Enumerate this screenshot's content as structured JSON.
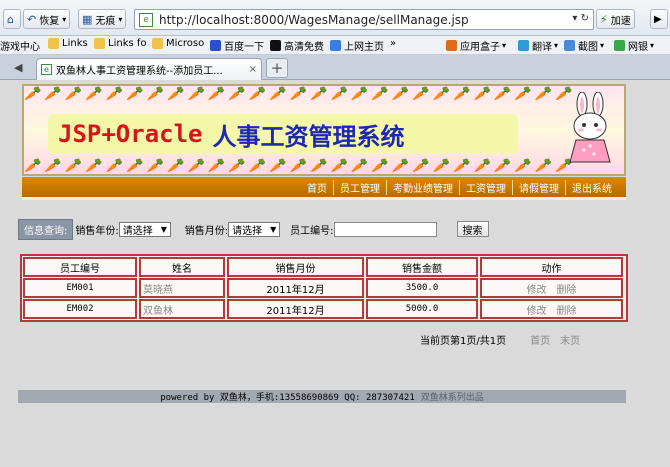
{
  "browser": {
    "back_label": "",
    "restore_label": "恢复",
    "no_trace_label": "无痕",
    "url": "http://localhost:8000/WagesManage/sellManage.jsp",
    "speedup_label": "加速",
    "bookmarks": [
      "游戏中心",
      "Links",
      "Links fo",
      "Microso",
      "百度一下",
      "高清免费",
      "上网主页",
      "»",
      "应用盒子",
      "翻译",
      "截图",
      "网银"
    ],
    "tab_title": "双鱼林人事工资管理系统--添加员工..."
  },
  "banner": {
    "title_en": "JSP+Oracle",
    "title_cn": "人事工资管理系统"
  },
  "nav": [
    "首页",
    "员工管理",
    "考勤业绩管理",
    "工资管理",
    "请假管理",
    "退出系统"
  ],
  "query": {
    "label": "信息查询:",
    "year_label": "销售年份:",
    "year_value": "请选择",
    "month_label": "销售月份:",
    "month_value": "请选择",
    "emp_label": "员工编号:",
    "emp_value": "",
    "search_label": "搜索"
  },
  "table": {
    "headers": [
      "员工编号",
      "姓名",
      "销售月份",
      "销售金额",
      "动作"
    ],
    "rows": [
      {
        "emp_no": "EM001",
        "name": "莫晓燕",
        "month": "2011年12月",
        "amount": "3500.0",
        "edit": "修改",
        "delete": "删除"
      },
      {
        "emp_no": "EM002",
        "name": "双鱼林",
        "month": "2011年12月",
        "amount": "5000.0",
        "edit": "修改",
        "delete": "删除"
      }
    ]
  },
  "pager": {
    "info": "当前页第1页/共1页",
    "first": "首页",
    "last": "末页"
  },
  "footer": {
    "powered": "powered by 双鱼林，手机:13558690869 QQ: 287307421",
    "series": "双鱼林系列出品"
  }
}
